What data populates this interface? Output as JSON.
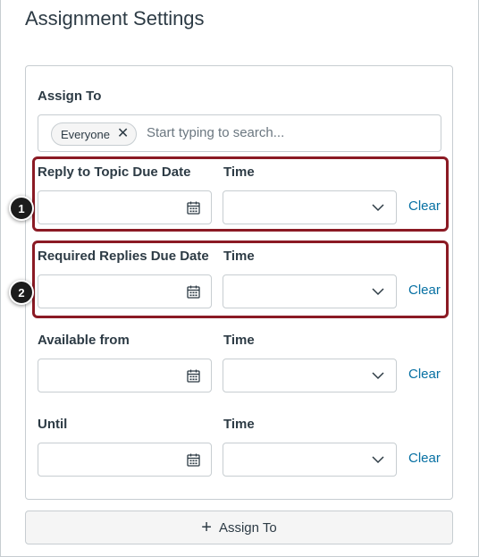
{
  "page": {
    "title": "Assignment Settings"
  },
  "assign_to": {
    "label": "Assign To",
    "chips": [
      {
        "label": "Everyone",
        "remove_icon": "close-icon"
      }
    ],
    "placeholder": "Start typing to search..."
  },
  "rows": [
    {
      "date_label": "Reply to Topic Due Date",
      "time_label": "Time",
      "date_value": "",
      "time_value": "",
      "clear_label": "Clear",
      "callout": "1"
    },
    {
      "date_label": "Required Replies Due Date",
      "time_label": "Time",
      "date_value": "",
      "time_value": "",
      "clear_label": "Clear",
      "callout": "2"
    },
    {
      "date_label": "Available from",
      "time_label": "Time",
      "date_value": "",
      "time_value": "",
      "clear_label": "Clear"
    },
    {
      "date_label": "Until",
      "time_label": "Time",
      "date_value": "",
      "time_value": "",
      "clear_label": "Clear"
    }
  ],
  "add_button": {
    "icon": "plus-icon",
    "label": "Assign To"
  },
  "colors": {
    "highlight": "#8b1a24",
    "link": "#0770a3",
    "text": "#2d3b45",
    "border": "#c7cdd1"
  }
}
